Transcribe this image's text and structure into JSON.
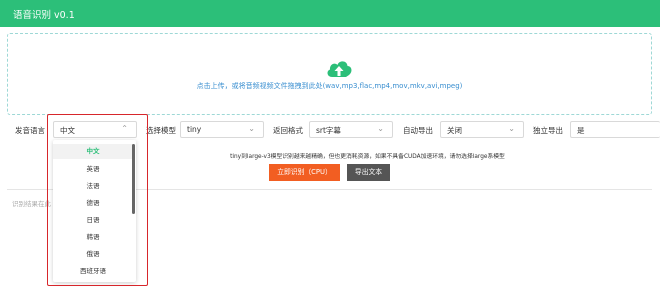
{
  "header": {
    "title": "语音识别 v0.1"
  },
  "upload": {
    "hint": "点击上传，或将音频视频文件拖拽到此处(wav,mp3,flac,mp4,mov,mkv,avi,mpeg)"
  },
  "controls": {
    "lang_label": "发音语言",
    "lang_value": "中文",
    "model_label": "选择模型",
    "model_value": "tiny",
    "format_label": "返回格式",
    "format_value": "srt字幕",
    "export_label": "自动导出",
    "export_value": "关闭",
    "indep_label": "独立导出",
    "indep_value": "是"
  },
  "description": "tiny到large-v3模型识别越来越精确，但也更消耗资源，如果不具备CUDA加速环境，请勿选择large系模型",
  "buttons": {
    "recognize": "立即识别（CPU）",
    "export_text": "导出文本"
  },
  "result": {
    "placeholder": "识别结果在此"
  },
  "dropdown": {
    "items": [
      "中文",
      "英语",
      "法语",
      "德语",
      "日语",
      "韩语",
      "俄语",
      "西班牙语"
    ],
    "selected": "中文"
  },
  "colors": {
    "brand": "#2cbf79",
    "primary_button": "#f25e22",
    "secondary_button": "#555555",
    "highlight_border": "#d7262b"
  }
}
